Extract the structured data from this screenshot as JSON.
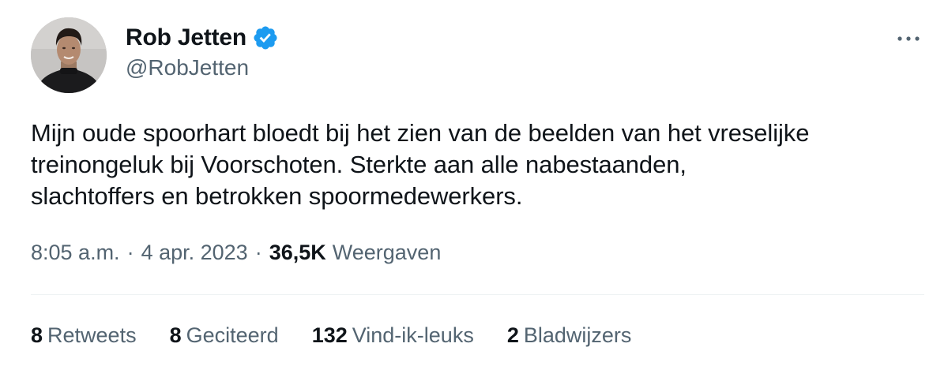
{
  "author": {
    "display_name": "Rob Jetten",
    "handle": "@RobJetten",
    "verified": true,
    "avatar_icon": "profile-photo"
  },
  "more_icon": "more-horizontal-icon",
  "tweet": {
    "text": "Mijn oude spoorhart bloedt bij het zien van de beelden van het vreselijke\ntreinongeluk bij Voorschoten. Sterkte aan alle nabestaanden,\nslachtoffers en betrokken spoormedewerkers."
  },
  "meta": {
    "time": "8:05 a.m.",
    "separator": "·",
    "date": "4 apr. 2023",
    "views_count": "36,5K",
    "views_label": "Weergaven"
  },
  "stats": [
    {
      "count": "8",
      "label": "Retweets"
    },
    {
      "count": "8",
      "label": "Geciteerd"
    },
    {
      "count": "132",
      "label": "Vind-ik-leuks"
    },
    {
      "count": "2",
      "label": "Bladwijzers"
    }
  ],
  "colors": {
    "text_primary": "#0f1419",
    "text_secondary": "#536471",
    "verified_blue": "#1d9bf0",
    "divider": "#eff3f4"
  }
}
